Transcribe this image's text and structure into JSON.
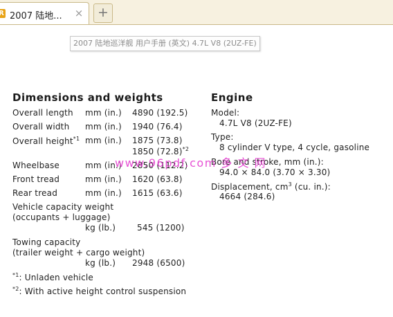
{
  "browser": {
    "tab_title": "2007 陆地...",
    "tab_icon": "pdf-reader-icon",
    "close_glyph": "×",
    "new_tab_glyph": "+",
    "tooltip": "2007 陆地巡洋舰 用户手册 (英文) 4.7L V8 (2UZ-FE)"
  },
  "watermark": "www.96pdf.com  多 文 网",
  "dimensions": {
    "heading": "Dimensions and weights",
    "rows": [
      {
        "label": "Overall length",
        "unit": "mm (in.)",
        "value": "4890 (192.5)"
      },
      {
        "label": "Overall width",
        "unit": "mm (in.)",
        "value": "1940 (76.4)"
      },
      {
        "label": "Overall height",
        "sup": "*1",
        "unit": "mm (in.)",
        "value": "1875 (73.8)",
        "value2": "1850 (72.8)",
        "sup2": "*2"
      },
      {
        "label": "Wheelbase",
        "unit": "mm (in.)",
        "value": "2850 (112.2)"
      },
      {
        "label": "Front tread",
        "unit": "mm (in.)",
        "value": "1620 (63.8)"
      },
      {
        "label": "Rear tread",
        "unit": "mm (in.)",
        "value": "1615 (63.6)"
      }
    ],
    "vehicle_capacity": {
      "line1": "Vehicle capacity weight",
      "line2": "(occupants + luggage)",
      "unit": "kg (lb.)",
      "value": "545 (1200)"
    },
    "towing_capacity": {
      "line1": "Towing capacity",
      "line2": "(trailer weight + cargo weight)",
      "unit": "kg (lb.)",
      "value": "2948 (6500)"
    },
    "notes": [
      {
        "mark": "*1",
        "text": ": Unladen vehicle"
      },
      {
        "mark": "*2",
        "text": ": With active height control suspension"
      }
    ]
  },
  "engine": {
    "heading": "Engine",
    "model_label": "Model:",
    "model_value": "4.7L V8 (2UZ-FE)",
    "type_label": "Type:",
    "type_value": "8 cylinder V type, 4 cycle, gasoline",
    "bore_label": "Bore and stroke, mm (in.):",
    "bore_value": "94.0 × 84.0 (3.70 × 3.30)",
    "displacement_label": "Displacement, cm",
    "displacement_sup": "3",
    "displacement_unit": " (cu. in.):",
    "displacement_value": "4664 (284.6)"
  }
}
